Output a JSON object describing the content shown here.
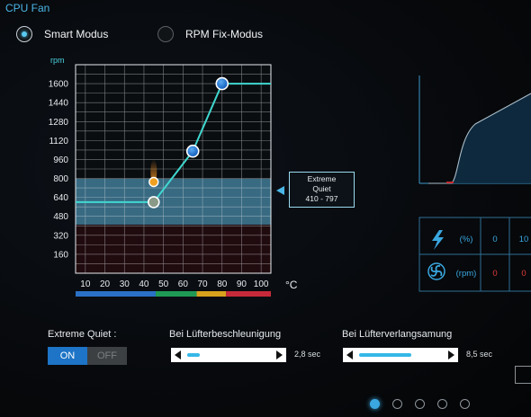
{
  "title": "CPU Fan",
  "modes": [
    {
      "label": "Smart Modus",
      "selected": true
    },
    {
      "label": "RPM Fix-Modus",
      "selected": false
    }
  ],
  "chart_data": {
    "type": "line",
    "ylabel": "rpm",
    "xlabel": "°C",
    "y_ticks": [
      160,
      320,
      480,
      640,
      800,
      960,
      1120,
      1280,
      1440,
      1600
    ],
    "x_ticks": [
      10,
      20,
      30,
      40,
      50,
      60,
      70,
      80,
      90,
      100
    ],
    "ylim": [
      0,
      1760
    ],
    "xlim": [
      0,
      100
    ],
    "curve": [
      {
        "x": 0,
        "y": 600
      },
      {
        "x": 40,
        "y": 600
      },
      {
        "x": 60,
        "y": 1030
      },
      {
        "x": 75,
        "y": 1600
      },
      {
        "x": 100,
        "y": 1600
      }
    ],
    "control_points": [
      {
        "x": 40,
        "y": 600
      },
      {
        "x": 60,
        "y": 1030
      },
      {
        "x": 75,
        "y": 1600
      }
    ],
    "current_point": {
      "x": 40,
      "y": 770
    },
    "quiet_band": {
      "from": 410,
      "to": 797
    },
    "temp_zones": [
      {
        "from": 0,
        "to": 41,
        "color": "#2a70c6"
      },
      {
        "from": 41,
        "to": 62,
        "color": "#1f9a55"
      },
      {
        "from": 62,
        "to": 77,
        "color": "#d8a21c"
      },
      {
        "from": 77,
        "to": 100,
        "color": "#c62a3a"
      }
    ],
    "grid": true
  },
  "tooltip": {
    "line1": "Extreme",
    "line2": "Quiet",
    "range": "410 - 797"
  },
  "stats": {
    "row1_unit": "(%)",
    "row1_values": [
      "0",
      "10"
    ],
    "row2_unit": "(rpm)",
    "row2_values": [
      "0",
      "0"
    ]
  },
  "extreme_quiet": {
    "label": "Extreme Quiet :",
    "on_label": "ON",
    "off_label": "OFF",
    "state": "ON"
  },
  "acceleration": {
    "label": "Bei Lüfterbeschleunigung",
    "value": "2,8 sec",
    "fraction": 0.15
  },
  "deceleration": {
    "label": "Bei Lüfterverlangsamung",
    "value": "8,5 sec",
    "fraction": 0.6
  },
  "pager": {
    "count": 5,
    "active": 0
  },
  "colors": {
    "accent": "#4bb6e6",
    "curve": "#40d8d0",
    "quiet_band": "#5fb8e0"
  }
}
